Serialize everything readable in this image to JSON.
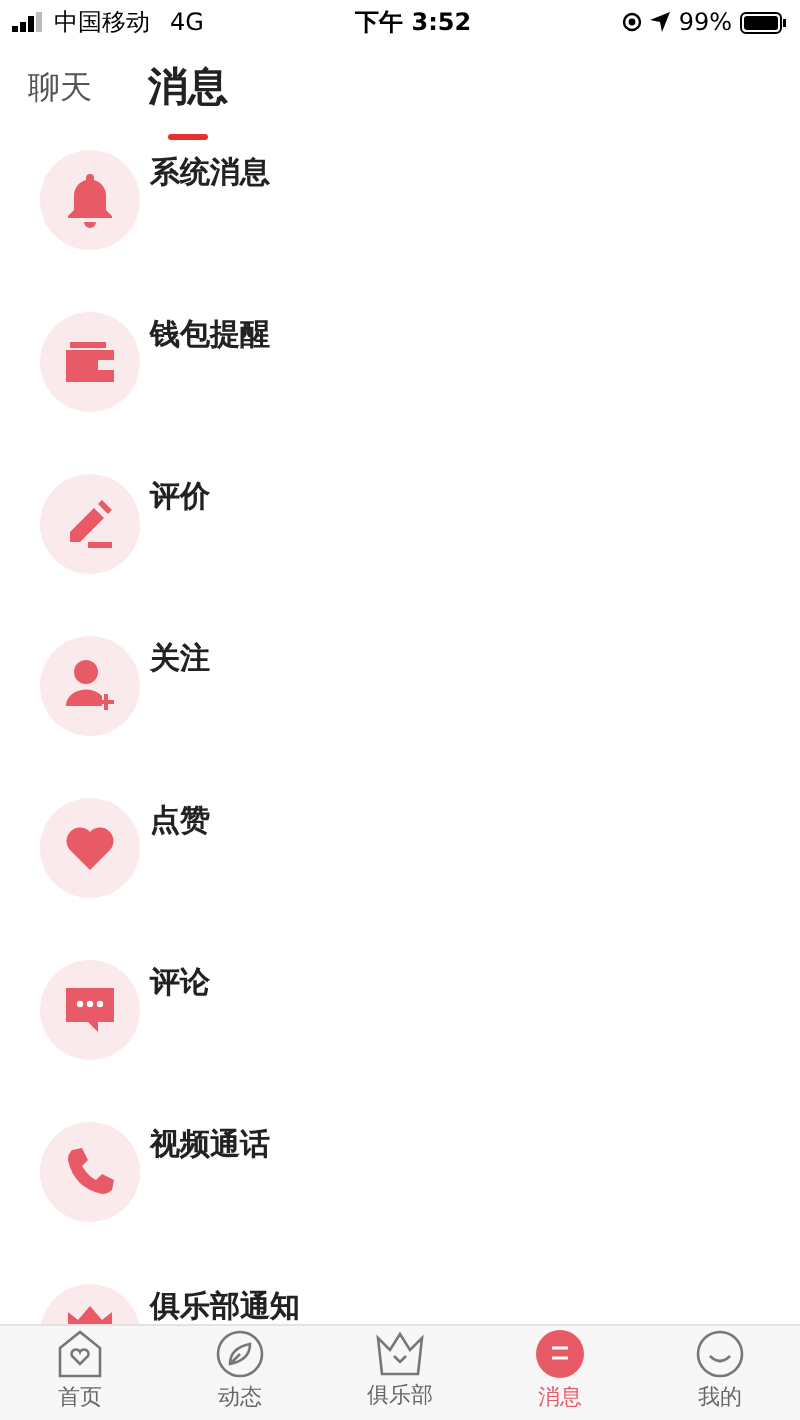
{
  "status_bar": {
    "carrier": "中国移动",
    "network": "4G",
    "time": "下午 3:52",
    "battery": "99%"
  },
  "tabs": [
    {
      "label": "聊天",
      "selected": false
    },
    {
      "label": "消息",
      "selected": true
    }
  ],
  "messages": [
    {
      "kind": "bell",
      "title": "系统消息"
    },
    {
      "kind": "wallet",
      "title": "钱包提醒"
    },
    {
      "kind": "pen",
      "title": "评价"
    },
    {
      "kind": "follow",
      "title": "关注"
    },
    {
      "kind": "heart",
      "title": "点赞"
    },
    {
      "kind": "comment",
      "title": "评论"
    },
    {
      "kind": "phone",
      "title": "视频通话"
    },
    {
      "kind": "club",
      "title": "俱乐部通知"
    }
  ],
  "bottom_nav": [
    {
      "kind": "home",
      "label": "首页",
      "selected": false
    },
    {
      "kind": "compass",
      "label": "动态",
      "selected": false
    },
    {
      "kind": "crown",
      "label": "俱乐部",
      "selected": false
    },
    {
      "kind": "chat",
      "label": "消息",
      "selected": true
    },
    {
      "kind": "smile",
      "label": "我的",
      "selected": false
    }
  ]
}
